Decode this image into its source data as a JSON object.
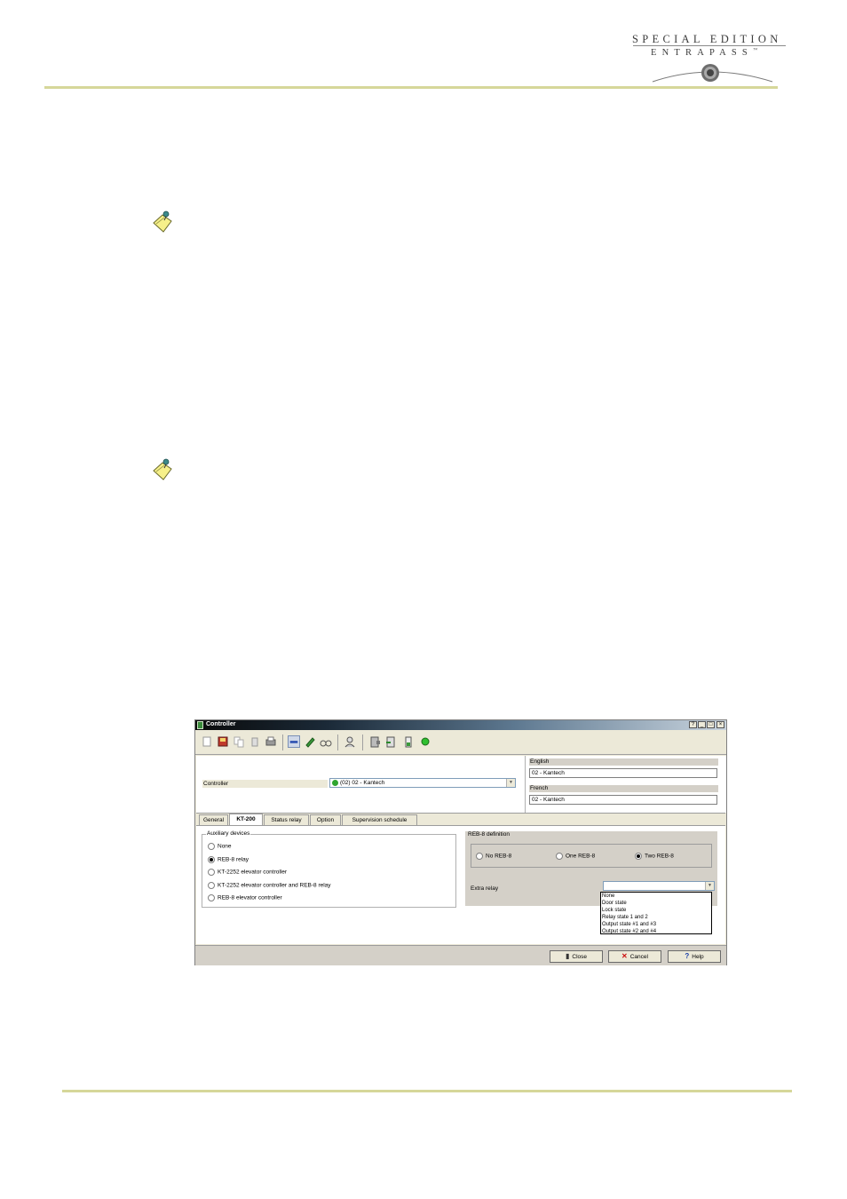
{
  "header": {
    "logo_line1": "SPECIAL EDITION",
    "logo_line2": "ENTRAPASS",
    "logo_mark": "™"
  },
  "window": {
    "title": "Controller",
    "controls": [
      "?",
      "_",
      "□",
      "×"
    ],
    "toolbar_icons": [
      "new-icon",
      "save-icon",
      "copy-icon",
      "delete-icon",
      "print-icon",
      "link-icon",
      "edit-pencil-icon",
      "binoculars-icon",
      "users-icon",
      "door-icon",
      "import-icon",
      "battery-icon",
      "status-green-icon"
    ],
    "controller_label": "Controller",
    "controller_value": "(02) 02 - Kantech",
    "english_label": "English",
    "english_value": "02 - Kantech",
    "french_label": "French",
    "french_value": "02 - Kantech",
    "tabs": [
      "General",
      "KT-200",
      "Status relay",
      "Option",
      "Supervision schedule"
    ],
    "selected_tab": "KT-200",
    "aux_legend": "Auxiliary devices",
    "aux_options": [
      "None",
      "REB-8 relay",
      "KT-2252 elevator controller",
      "KT-2252 elevator controller and REB-8 relay",
      "REB-8 elevator controller"
    ],
    "aux_selected": "REB-8 relay",
    "reb_legend": "REB-8 definition",
    "reb_options": [
      "No REB-8",
      "One REB-8",
      "Two REB-8"
    ],
    "reb_selected": "Two REB-8",
    "extra_relay_label": "Extra relay",
    "extra_relay_value": "",
    "extra_relay_options": [
      "None",
      "Door state",
      "Lock state",
      "Relay state 1 and 2",
      "Output state #1 and #3",
      "Output state #2 and #4"
    ],
    "buttons": {
      "close": "Close",
      "cancel": "Cancel",
      "help": "Help"
    },
    "colors": {
      "status_dot": "#2fa52f",
      "cancel_x": "#cc1111",
      "rule": "#d6d79a"
    }
  }
}
